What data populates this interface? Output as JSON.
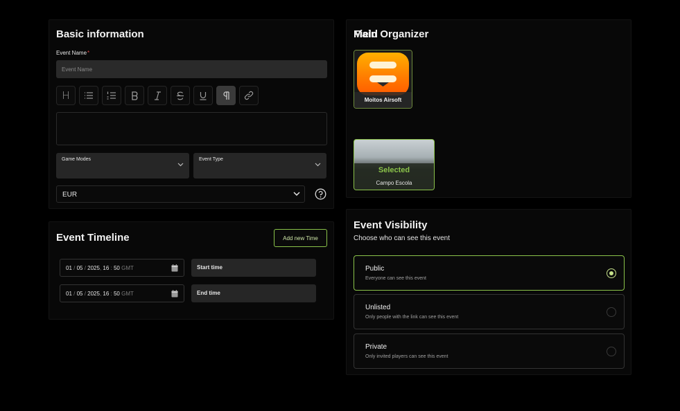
{
  "basic_info": {
    "title": "Basic information",
    "event_name_label": "Event Name",
    "required_mark": "*",
    "event_name_placeholder": "Event Name",
    "event_name_value": "",
    "toolbar": [
      {
        "name": "heading",
        "glyph": "H"
      },
      {
        "name": "bullet-list",
        "glyph": "list"
      },
      {
        "name": "ordered-list",
        "glyph": "olist"
      },
      {
        "name": "bold",
        "glyph": "B"
      },
      {
        "name": "italic",
        "glyph": "I"
      },
      {
        "name": "strikethrough",
        "glyph": "S"
      },
      {
        "name": "underline",
        "glyph": "U"
      },
      {
        "name": "paragraph",
        "glyph": "¶",
        "active": true
      },
      {
        "name": "link",
        "glyph": "link"
      }
    ],
    "game_modes_label": "Game Modes",
    "event_type_label": "Event Type",
    "currency_value": "EUR"
  },
  "timeline": {
    "title": "Event Timeline",
    "add_button": "Add new Time",
    "rows": [
      {
        "day": "01",
        "month": "05",
        "year": "2025",
        "hour": "16",
        "minute": "50",
        "tz": "GMT",
        "label": "Start time"
      },
      {
        "day": "01",
        "month": "05",
        "year": "2025",
        "hour": "16",
        "minute": "50",
        "tz": "GMT",
        "label": "End time"
      }
    ]
  },
  "organizer": {
    "title": "Main Organizer",
    "name": "Moitos Airsoft",
    "logo_color": "#ff8c00"
  },
  "field": {
    "title": "Field",
    "selected_text": "Selected",
    "name": "Campo Escola"
  },
  "visibility": {
    "title": "Event Visibility",
    "subtitle": "Choose who can see this event",
    "options": [
      {
        "title": "Public",
        "desc": "Everyone can see this event",
        "selected": true
      },
      {
        "title": "Unlisted",
        "desc": "Only people with the link can see this event",
        "selected": false
      },
      {
        "title": "Private",
        "desc": "Only invited players can see this event",
        "selected": false
      }
    ]
  },
  "colors": {
    "accent": "#8bc34a",
    "background": "#000000",
    "card": "#080808",
    "required": "#e04848"
  }
}
